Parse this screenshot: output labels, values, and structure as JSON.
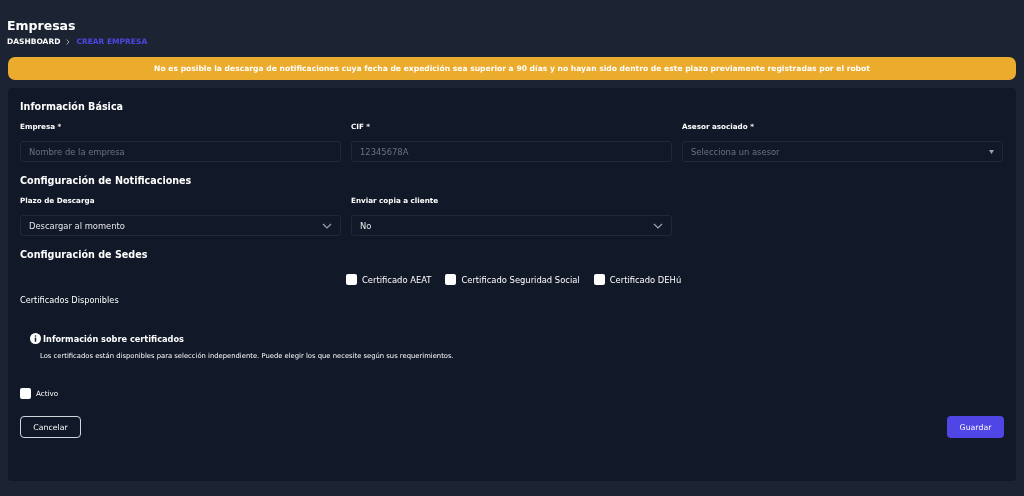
{
  "page": {
    "title": "Empresas",
    "breadcrumb": [
      {
        "label": "DASHBOARD",
        "current": false
      },
      {
        "label": "CREAR EMPRESA",
        "current": true
      }
    ]
  },
  "banner": "No es posible la descarga de notificaciones cuya fecha de expedición sea superior a 90 días y no hayan sido dentro de este plazo previamente registradas por el robot",
  "basic": {
    "heading": "Información Básica",
    "fields": [
      {
        "label": "Empresa *",
        "kind": "text",
        "placeholder": "Nombre de la empresa"
      },
      {
        "label": "CIF *",
        "kind": "text",
        "placeholder": "12345678A"
      },
      {
        "label": "Asesor asociado *",
        "kind": "select",
        "placeholder": "Selecciona un asesor"
      }
    ]
  },
  "notifications": {
    "heading": "Configuración de Notificaciones",
    "fields": [
      {
        "label": "Plazo de Descarga",
        "kind": "select",
        "value": "Descargar al momento"
      },
      {
        "label": "Enviar copia a cliente",
        "kind": "select",
        "value": "No"
      }
    ]
  },
  "sedes": {
    "heading": "Configuración de Sedes",
    "certificates": [
      {
        "label": "Certificado AEAT",
        "checked": false
      },
      {
        "label": "Certificado Seguridad Social",
        "checked": false
      },
      {
        "label": "Certificado DEHú",
        "checked": false
      }
    ],
    "available_label": "Certificados Disponibles",
    "info": {
      "title": "Información sobre certificados",
      "text": "Los certificados están disponibles para selección independiente. Puede elegir los que necesite según sus requerimientos."
    }
  },
  "active": {
    "label": "Activo",
    "checked": false
  },
  "buttons": {
    "cancel": "Cancelar",
    "save": "Guardar"
  }
}
